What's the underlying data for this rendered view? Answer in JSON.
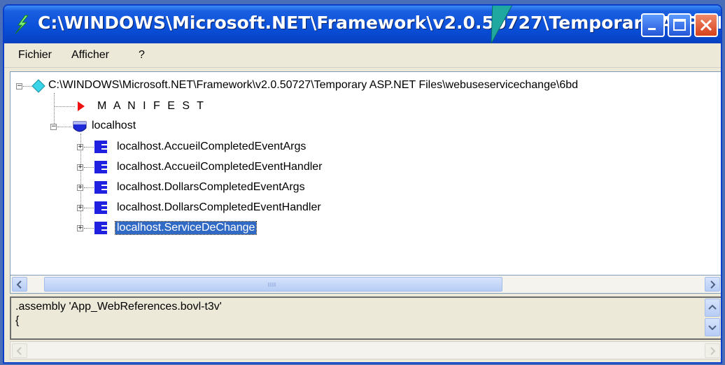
{
  "window": {
    "title": "C:\\WINDOWS\\Microsoft.NET\\Framework\\v2.0.50727\\Temporary ASP.NE...",
    "accent_color": "#0a4fd8"
  },
  "menu": {
    "items": [
      {
        "label": "Fichier"
      },
      {
        "label": "Afficher"
      },
      {
        "label": "?"
      }
    ]
  },
  "tree": {
    "root": {
      "label": "C:\\WINDOWS\\Microsoft.NET\\Framework\\v2.0.50727\\Temporary ASP.NET Files\\webuseservicechange\\6bd",
      "icon": "assembly-diamond-icon"
    },
    "manifest": {
      "label": "M A N I F E S T",
      "icon": "manifest-arrow-icon"
    },
    "namespace": {
      "label": "localhost",
      "icon": "namespace-shield-icon"
    },
    "classes": [
      {
        "label": "localhost.AccueilCompletedEventArgs"
      },
      {
        "label": "localhost.AccueilCompletedEventHandler"
      },
      {
        "label": "localhost.DollarsCompletedEventArgs"
      },
      {
        "label": "localhost.DollarsCompletedEventHandler"
      },
      {
        "label": "localhost.ServiceDeChange",
        "selected": true
      }
    ],
    "selection_color": "#316ac5"
  },
  "detail": {
    "lines": [
      ".assembly 'App_WebReferences.bovl-t3v'",
      "{"
    ]
  }
}
